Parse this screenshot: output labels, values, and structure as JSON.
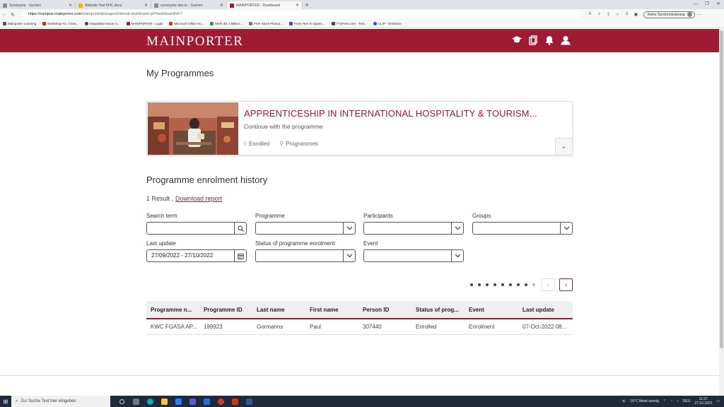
{
  "browser": {
    "tabs": [
      {
        "label": "Synonyme - Suchen",
        "active": false,
        "color": "#8a8a8a"
      },
      {
        "label": "Website Text KHC.docx",
        "active": false,
        "color": "#f4b400"
      },
      {
        "label": "synonyme dan to - Suchen",
        "active": false,
        "color": "#8a8a8a"
      },
      {
        "label": "MAINPORTER - Dashboard",
        "active": true,
        "color": "#9e1b32"
      }
    ],
    "new_tab_label": "+",
    "url_host": "https://campus.mainporter.com",
    "url_path": "/mainporterlp/pages/internal-dashboard.jsf?dashboardId=7",
    "sync_button_label": "Keine Synchronisierung",
    "bookmarks": [
      {
        "label": "Mainporter Learning",
        "color": "#555555"
      },
      {
        "label": "Workshop #1: Creat...",
        "color": "#e62117"
      },
      {
        "label": "hospitality lesson vi...",
        "color": "#444444"
      },
      {
        "label": "MAINPORTER - Login",
        "color": "#9e1b32"
      },
      {
        "label": "Microsoft Office Ho...",
        "color": "#d83b01"
      },
      {
        "label": "Mehr als 1 Million...",
        "color": "#2ea043"
      },
      {
        "label": "Free Stock Photos...",
        "color": "#7a7a7a"
      },
      {
        "label": "From Text To Speec...",
        "color": "#3355aa"
      },
      {
        "label": "TTSFree.com - Text...",
        "color": "#444444"
      },
      {
        "label": "CLIP - OneDrive",
        "color": "#0a64c8"
      }
    ]
  },
  "header": {
    "logo": "MAINPORTER",
    "icons": [
      "graduation-cap-icon",
      "documents-icon",
      "bell-icon",
      "user-icon"
    ]
  },
  "page": {
    "title": "My Programmes",
    "programme_card": {
      "title": "APPRENTICESHIP IN INTERNATIONAL HOSPITALITY & TOURISM...",
      "subtitle": "Continue with the programme",
      "status": "Enrolled",
      "category": "Programmes"
    },
    "history_title": "Programme enrolment history",
    "results_count": "1 Result ,",
    "download_label": "Download report",
    "filters": {
      "search_term_label": "Search term",
      "search_term_value": "",
      "programme_label": "Programme",
      "participants_label": "Participants",
      "groups_label": "Groups",
      "last_update_label": "Last update",
      "last_update_value": "27/09/2022 - 27/10/2022",
      "status_label": "Status of programme enrolment",
      "event_label": "Event"
    },
    "table": {
      "headers": [
        "Programme n...",
        "Programme ID",
        "Last name",
        "First name",
        "Person ID",
        "Status of prog...",
        "Event",
        "Last update"
      ],
      "rows": [
        [
          "KWC FGASA AP...",
          "199923",
          "Gormanns",
          "Paul",
          "307440",
          "Enrolled",
          "Enrolment",
          "07-Oct-2022 08..."
        ]
      ]
    }
  },
  "taskbar": {
    "search_placeholder": "Zur Suche Text hier eingeben",
    "weather": "16°C Meist sonnig",
    "language": "DEU",
    "time": "11:27",
    "date": "27.10.2022"
  }
}
